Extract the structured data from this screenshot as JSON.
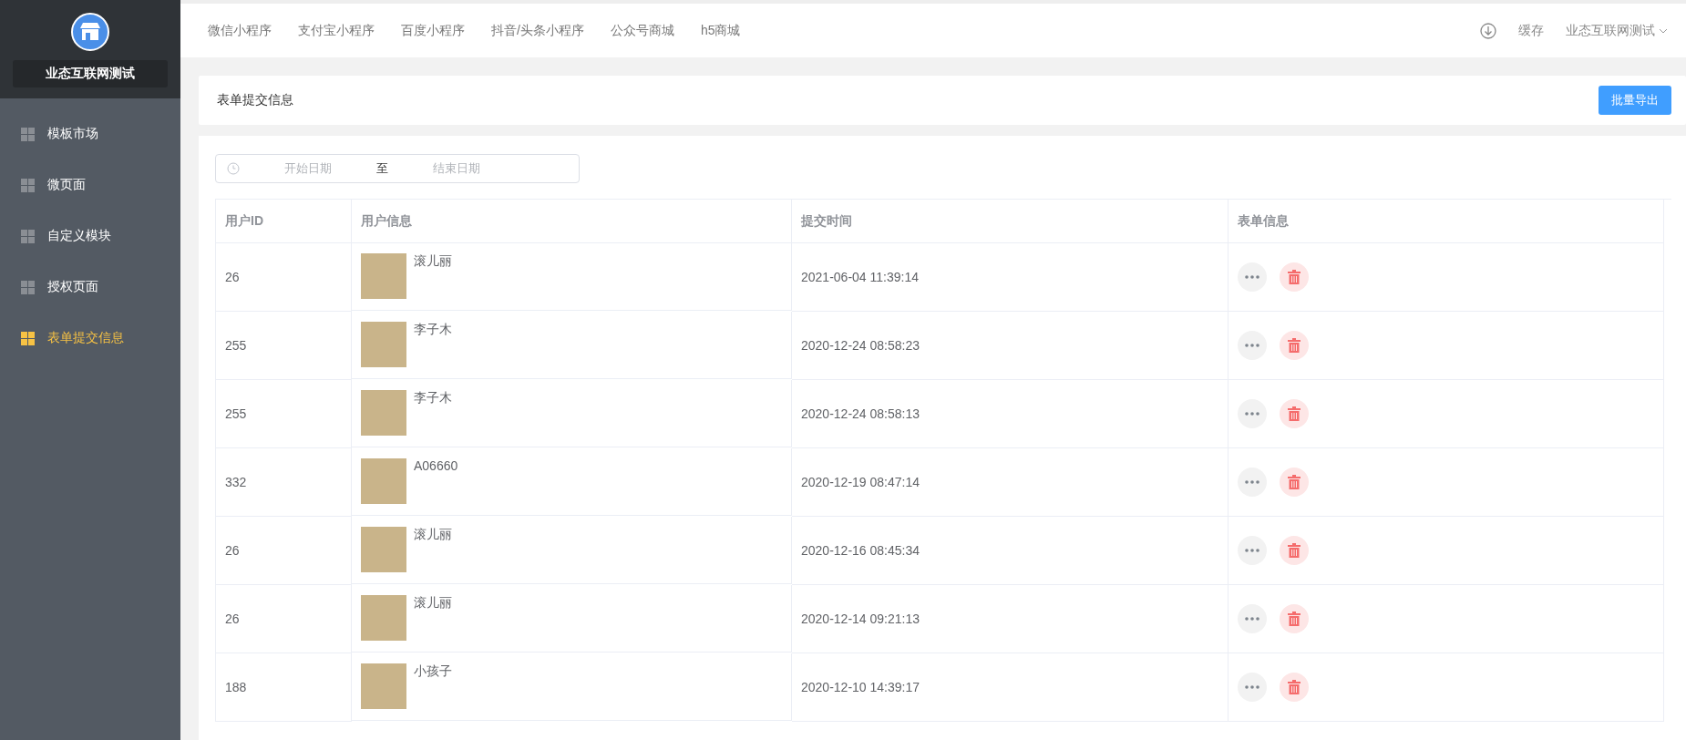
{
  "sidebar": {
    "brand": "业态互联网测试",
    "items": [
      {
        "label": "模板市场",
        "selected": false
      },
      {
        "label": "微页面",
        "selected": false
      },
      {
        "label": "自定义模块",
        "selected": false
      },
      {
        "label": "授权页面",
        "selected": false
      },
      {
        "label": "表单提交信息",
        "selected": true
      }
    ]
  },
  "topbar": {
    "tabs": [
      "微信小程序",
      "支付宝小程序",
      "百度小程序",
      "抖音/头条小程序",
      "公众号商城",
      "h5商城"
    ],
    "cache": "缓存",
    "account": "业态互联网测试"
  },
  "header": {
    "title": "表单提交信息",
    "export_button": "批量导出"
  },
  "date_range": {
    "start_placeholder": "开始日期",
    "separator": "至",
    "end_placeholder": "结束日期"
  },
  "table": {
    "columns": [
      "用户ID",
      "用户信息",
      "提交时间",
      "表单信息"
    ],
    "rows": [
      {
        "id": "26",
        "name": "滚儿丽",
        "time": "2021-06-04 11:39:14"
      },
      {
        "id": "255",
        "name": "李子木",
        "time": "2020-12-24 08:58:23"
      },
      {
        "id": "255",
        "name": "李子木",
        "time": "2020-12-24 08:58:13"
      },
      {
        "id": "332",
        "name": "A06660",
        "time": "2020-12-19 08:47:14"
      },
      {
        "id": "26",
        "name": "滚儿丽",
        "time": "2020-12-16 08:45:34"
      },
      {
        "id": "26",
        "name": "滚儿丽",
        "time": "2020-12-14 09:21:13"
      },
      {
        "id": "188",
        "name": "小孩子",
        "time": "2020-12-10 14:39:17"
      }
    ]
  }
}
